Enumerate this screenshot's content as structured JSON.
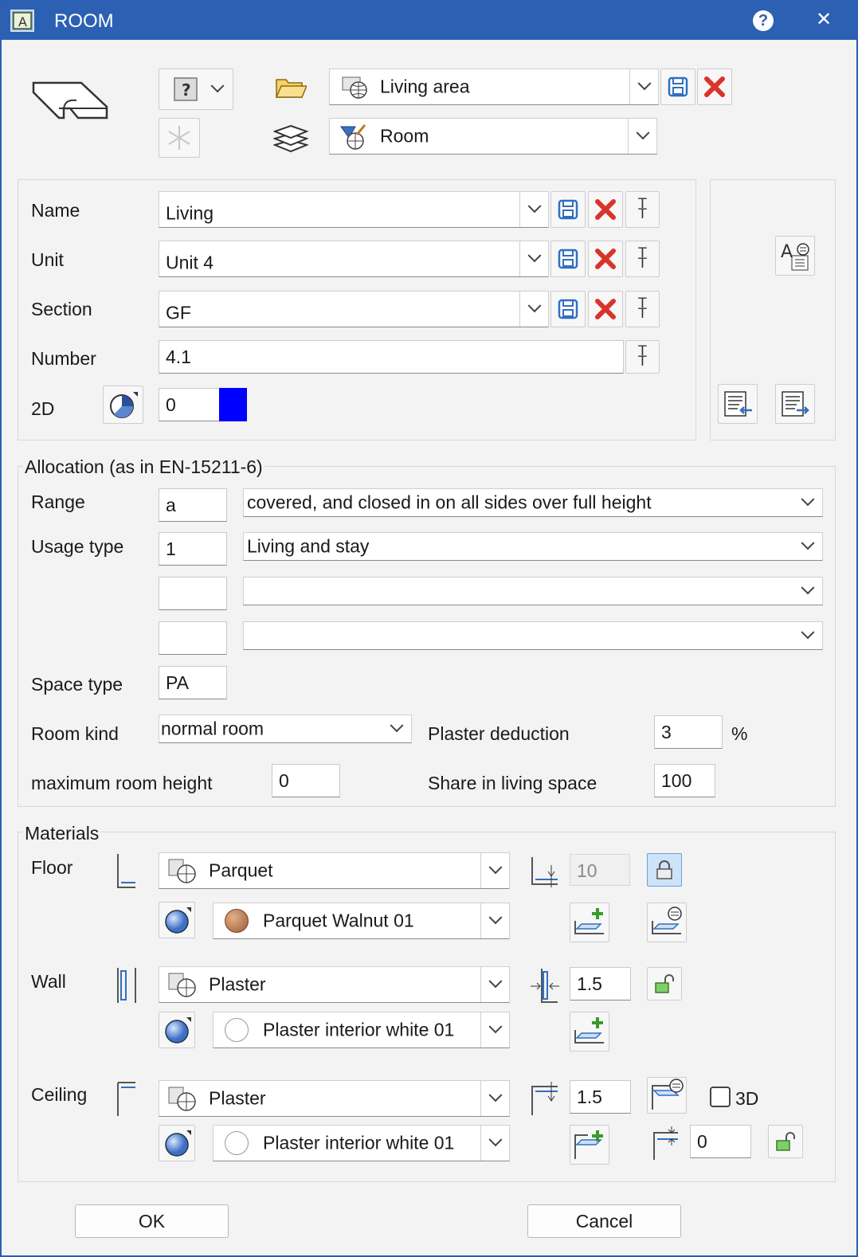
{
  "window": {
    "title": "ROOM",
    "help_glyph": "?",
    "close_glyph": "✕"
  },
  "header": {
    "style_value": "Living area",
    "layer_value": "Room",
    "help_icon_glyph": "?"
  },
  "props": {
    "name_label": "Name",
    "name_value": "Living",
    "unit_label": "Unit",
    "unit_value": "Unit 4",
    "section_label": "Section",
    "section_value": "GF",
    "number_label": "Number",
    "number_value": "4.1",
    "twod_label": "2D",
    "twod_value": "0",
    "twod_color": "#0000ff"
  },
  "allocation": {
    "title": "Allocation (as in EN-15211-6)",
    "range_label": "Range",
    "range_code": "a",
    "range_value": "covered, and closed in on all sides over full height",
    "usage_label": "Usage type",
    "usage_code": "1",
    "usage_value": "Living and stay",
    "usage2_code": "",
    "usage2_value": "",
    "usage3_code": "",
    "usage3_value": "",
    "space_label": "Space type",
    "space_value": "PA",
    "roomkind_label": "Room kind",
    "roomkind_value": "normal room",
    "plaster_label": "Plaster deduction",
    "plaster_value": "3",
    "plaster_unit": "%",
    "maxheight_label": "maximum room height",
    "maxheight_value": "0",
    "share_label": "Share in living space",
    "share_value": "100"
  },
  "materials": {
    "title": "Materials",
    "floor_label": "Floor",
    "floor_material": "Parquet",
    "floor_surface": "Parquet Walnut 01",
    "floor_thickness": "10",
    "wall_label": "Wall",
    "wall_material": "Plaster",
    "wall_surface": "Plaster interior white 01",
    "wall_thickness": "1.5",
    "ceiling_label": "Ceiling",
    "ceiling_material": "Plaster",
    "ceiling_surface": "Plaster interior white 01",
    "ceiling_thickness": "1.5",
    "ceiling_offset": "0",
    "threed_label": "3D"
  },
  "footer": {
    "ok_label": "OK",
    "cancel_label": "Cancel"
  },
  "colors": {
    "titlebar": "#2c60b3",
    "accent_red": "#d9342b",
    "save_blue": "#2f6fc2"
  }
}
